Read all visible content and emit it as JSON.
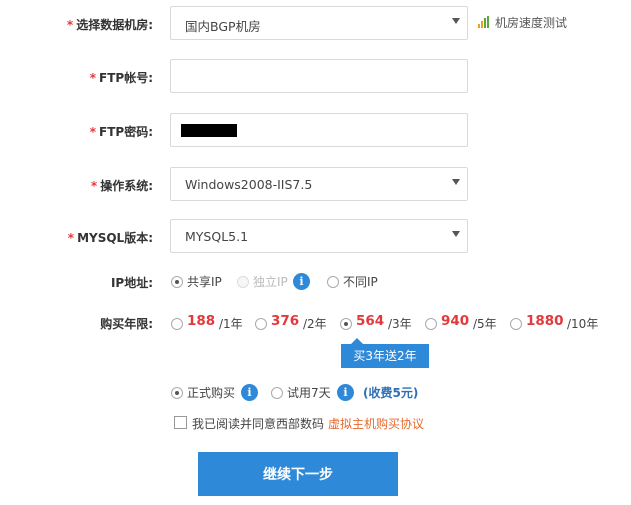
{
  "form": {
    "datacenter": {
      "label": "选择数据机房:",
      "value": "国内BGP机房",
      "speed_test": "机房速度测试"
    },
    "ftp_account": {
      "label": "FTP帐号:",
      "value": ""
    },
    "ftp_password": {
      "label": "FTP密码:"
    },
    "os": {
      "label": "操作系统:",
      "value": "Windows2008-IIS7.5"
    },
    "mysql": {
      "label": "MYSQL版本:",
      "value": "MYSQL5.1"
    },
    "required_mark": "*",
    "ip": {
      "label": "IP地址:",
      "options": [
        {
          "text": "共享IP",
          "selected": true
        },
        {
          "text": "独立IP",
          "disabled": true
        },
        {
          "text": "不同IP"
        }
      ]
    },
    "years": {
      "label": "购买年限:",
      "options": [
        {
          "price": "188",
          "unit": "/1年"
        },
        {
          "price": "376",
          "unit": "/2年"
        },
        {
          "price": "564",
          "unit": "/3年",
          "selected": true
        },
        {
          "price": "940",
          "unit": "/5年"
        },
        {
          "price": "1880",
          "unit": "/10年"
        }
      ],
      "promo": "买3年送2年"
    },
    "purchase": {
      "formal": "正式购买",
      "trial": "试用7天",
      "trial_fee": "(收费5元)"
    },
    "agreement": {
      "text": "我已阅读并同意西部数码",
      "link": "虚拟主机购买协议"
    },
    "next_button": "继续下一步"
  },
  "colors": {
    "accent": "#2e8ad8",
    "required": "#e4393c",
    "price": "#e4393c",
    "link": "#e46a2e"
  },
  "icons": {
    "info": "info-icon",
    "speed": "bar-chart-icon",
    "dropdown": "chevron-down-icon"
  }
}
